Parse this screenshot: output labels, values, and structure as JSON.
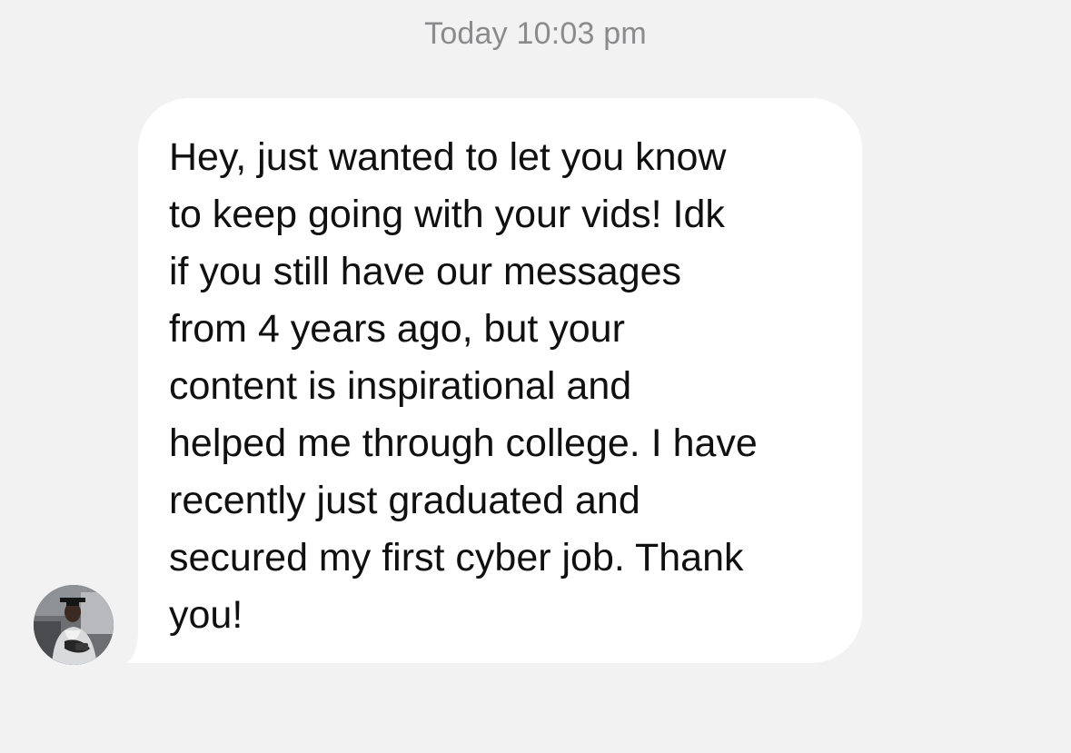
{
  "thread": {
    "timestamp": "Today 10:03 pm",
    "message": {
      "sender_avatar_icon": "graduate-avatar",
      "text": "Hey, just wanted to let you know\nto keep going with your vids! Idk\nif you still have our messages\nfrom 4 years ago, but your\ncontent is inspirational and\nhelped me through college. I have\nrecently just graduated and\nsecured my first cyber job. Thank\nyou!"
    }
  },
  "colors": {
    "background": "#f2f2f2",
    "bubble": "#ffffff",
    "timestamp_text": "#8b8b8d",
    "message_text": "#101010"
  }
}
